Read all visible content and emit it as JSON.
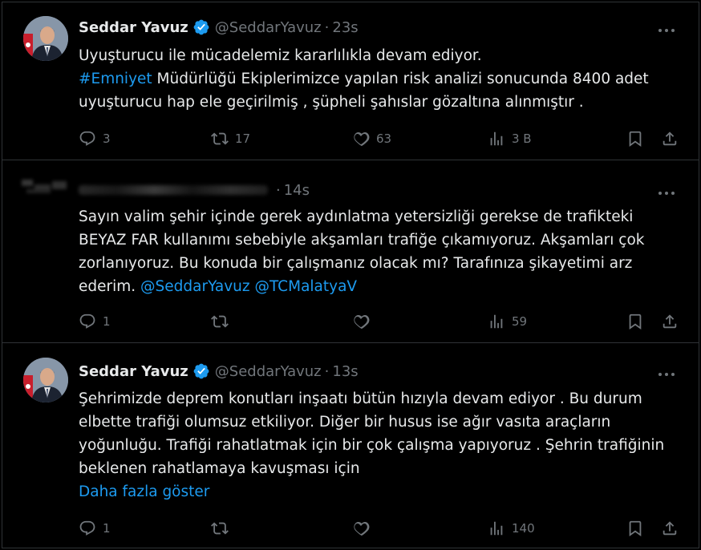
{
  "tweets": [
    {
      "author_name": "Seddar Yavuz",
      "handle": "@SeddarYavuz",
      "separator": "·",
      "time": "23s",
      "lines": [
        {
          "parts": [
            {
              "text": "Uyuşturucu ile mücadelemiz kararlılıkla devam ediyor.",
              "link": false
            }
          ]
        },
        {
          "parts": [
            {
              "text": "#Emniyet",
              "link": true
            },
            {
              "text": " Müdürlüğü Ekiplerimizce yapılan  risk analizi sonucunda 8400 adet",
              "link": false
            }
          ]
        },
        {
          "parts": [
            {
              "text": "uyuşturucu hap ele geçirilmiş , şüpheli şahıslar gözaltına alınmıştır .",
              "link": false
            }
          ]
        }
      ],
      "replies": "3",
      "retweets": "17",
      "likes": "63",
      "views": "3 B"
    },
    {
      "author_name": "",
      "handle": "",
      "separator": "·",
      "time": "14s",
      "lines": [
        {
          "parts": [
            {
              "text": "Sayın valim şehir içinde gerek aydınlatma yetersizliği gerekse de trafikteki",
              "link": false
            }
          ]
        },
        {
          "parts": [
            {
              "text": "BEYAZ FAR kullanımı sebebiyle akşamları trafiğe çıkamıyoruz. Akşamları çok",
              "link": false
            }
          ]
        },
        {
          "parts": [
            {
              "text": "zorlanıyoruz. Bu konuda bir çalışmanız olacak mı? Tarafınıza şikayetimi arz",
              "link": false
            }
          ]
        },
        {
          "parts": [
            {
              "text": "ederim. ",
              "link": false
            },
            {
              "text": "@SeddarYavuz",
              "link": true
            },
            {
              "text": " ",
              "link": false
            },
            {
              "text": "@TCMalatyaV",
              "link": true
            }
          ]
        }
      ],
      "replies": "1",
      "retweets": "",
      "likes": "",
      "views": "59"
    },
    {
      "author_name": "Seddar Yavuz",
      "handle": "@SeddarYavuz",
      "separator": "·",
      "time": "13s",
      "lines": [
        {
          "parts": [
            {
              "text": "Şehrimizde deprem konutları inşaatı bütün hızıyla devam ediyor . Bu durum",
              "link": false
            }
          ]
        },
        {
          "parts": [
            {
              "text": "elbette trafiği olumsuz etkiliyor. Diğer bir husus ise ağır vasıta araçların",
              "link": false
            }
          ]
        },
        {
          "parts": [
            {
              "text": "yoğunluğu. Trafiği rahatlatmak için bir çok çalışma yapıyoruz . Şehrin trafiğinin",
              "link": false
            }
          ]
        },
        {
          "parts": [
            {
              "text": "beklenen rahatlamaya kavuşması için",
              "link": false
            }
          ]
        }
      ],
      "show_more": "Daha fazla göster",
      "replies": "1",
      "retweets": "",
      "likes": "",
      "views": "140"
    }
  ],
  "colors": {
    "background": "#000000",
    "text": "#e7e9ea",
    "muted": "#71767b",
    "link": "#1d9bf0",
    "verified": "#1d9bf0",
    "divider": "#2f3336"
  },
  "icons": {
    "reply": "reply-icon",
    "retweet": "retweet-icon",
    "like": "heart-icon",
    "views": "views-icon",
    "bookmark": "bookmark-icon",
    "share": "share-icon",
    "more": "more-icon",
    "verified": "verified-badge-icon"
  }
}
